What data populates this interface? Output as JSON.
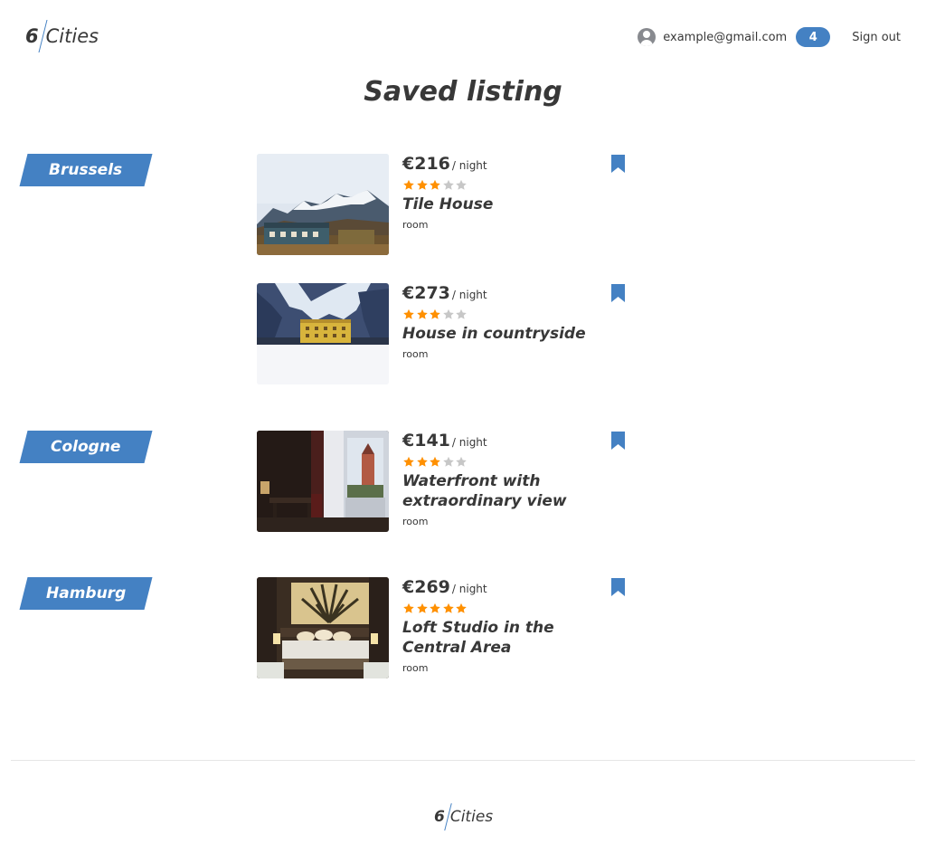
{
  "header": {
    "logo_num": "6",
    "logo_text": "Cities",
    "user_email": "example@gmail.com",
    "favorites_count": "4",
    "sign_out_label": "Sign out",
    "avatar_icon": "user-avatar-icon"
  },
  "page_title": "Saved listing",
  "groups": [
    {
      "city": "Brussels",
      "offers": [
        {
          "price": "€216",
          "per": "/ night",
          "rating": 3,
          "name": "Tile House",
          "type": "room",
          "bookmarked": true
        },
        {
          "price": "€273",
          "per": "/ night",
          "rating": 3,
          "name": "House in countryside",
          "type": "room",
          "bookmarked": true
        }
      ]
    },
    {
      "city": "Cologne",
      "offers": [
        {
          "price": "€141",
          "per": "/ night",
          "rating": 3,
          "name": "Waterfront with extraordinary view",
          "type": "room",
          "bookmarked": true
        }
      ]
    },
    {
      "city": "Hamburg",
      "offers": [
        {
          "price": "€269",
          "per": "/ night",
          "rating": 5,
          "name": "Loft Studio in the Central Area",
          "type": "room",
          "bookmarked": true
        }
      ]
    }
  ],
  "footer": {
    "logo_num": "6",
    "logo_text": "Cities"
  },
  "colors": {
    "accent": "#4481c3",
    "star_on": "#ff9000",
    "star_off": "#c7c7c7",
    "text": "#383838"
  }
}
